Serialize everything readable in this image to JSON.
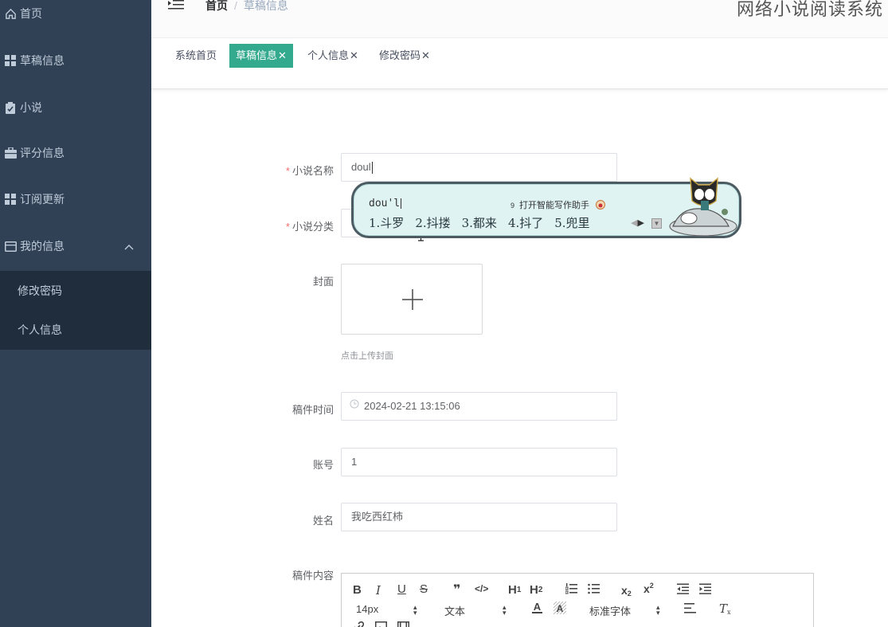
{
  "sidebar": {
    "items": [
      {
        "label": "首页",
        "icon": "home-icon"
      },
      {
        "label": "草稿信息",
        "icon": "grid-icon"
      },
      {
        "label": "小说",
        "icon": "clipboard-icon"
      },
      {
        "label": "评分信息",
        "icon": "briefcase-icon"
      },
      {
        "label": "订阅更新",
        "icon": "grid-icon"
      },
      {
        "label": "我的信息",
        "icon": "card-icon"
      }
    ],
    "submenu": [
      {
        "label": "修改密码"
      },
      {
        "label": "个人信息"
      }
    ]
  },
  "header": {
    "breadcrumb_home": "首页",
    "breadcrumb_sep": "/",
    "breadcrumb_current": "草稿信息",
    "system_title": "网络小说阅读系统"
  },
  "tags": [
    {
      "label": "系统首页",
      "close": ""
    },
    {
      "label": "草稿信息",
      "close": "✕"
    },
    {
      "label": "个人信息",
      "close": "✕"
    },
    {
      "label": "修改密码",
      "close": "✕"
    }
  ],
  "form": {
    "novel_name_label": "小说名称",
    "novel_name_value": "doul",
    "category_label": "小说分类",
    "cover_label": "封面",
    "cover_hint": "点击上传封面",
    "time_label": "稿件时间",
    "time_value": "2024-02-21 13:15:06",
    "account_label": "账号",
    "account_value": "1",
    "name_label": "姓名",
    "name_value": "我吃西红柿",
    "content_label": "稿件内容",
    "required_mark": "*"
  },
  "editor": {
    "font_size": "14px",
    "text_style": "文本",
    "font_family": "标准字体"
  },
  "ime": {
    "composition": "dou'l",
    "assist_key": "9",
    "assist_label": "打开智能写作助手",
    "candidates": [
      "1.斗罗",
      "2.抖搂",
      "3.都来",
      "4.抖了",
      "5.兜里"
    ]
  },
  "colors": {
    "sidebar_bg": "#304156",
    "submenu_bg": "#1f2d3d",
    "active_tag": "#33a98e",
    "required": "#f56c6c"
  }
}
